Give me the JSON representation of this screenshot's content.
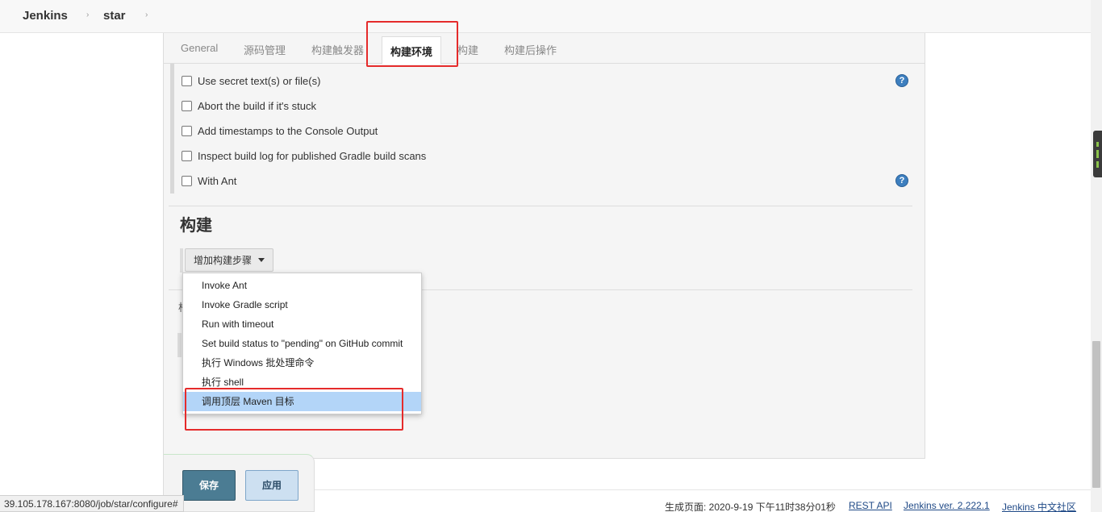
{
  "breadcrumb": {
    "items": [
      "Jenkins",
      "star"
    ],
    "separator": "›"
  },
  "tabs": [
    {
      "label": "General",
      "active": false
    },
    {
      "label": "源码管理",
      "active": false
    },
    {
      "label": "构建触发器",
      "active": false
    },
    {
      "label": "构建环境",
      "active": true
    },
    {
      "label": "构建",
      "active": false
    },
    {
      "label": "构建后操作",
      "active": false
    }
  ],
  "build_env": {
    "options": [
      {
        "label": "Use secret text(s) or file(s)",
        "checked": false,
        "help": true
      },
      {
        "label": "Abort the build if it's stuck",
        "checked": false,
        "help": false
      },
      {
        "label": "Add timestamps to the Console Output",
        "checked": false,
        "help": false
      },
      {
        "label": "Inspect build log for published Gradle build scans",
        "checked": false,
        "help": false
      },
      {
        "label": "With Ant",
        "checked": false,
        "help": true
      }
    ],
    "help_glyph": "?"
  },
  "build_section": {
    "title": "构建",
    "add_step_label": "增加构建步骤",
    "hidden_section_stub": "构"
  },
  "dropdown": {
    "items": [
      {
        "label": "Invoke Ant",
        "selected": false
      },
      {
        "label": "Invoke Gradle script",
        "selected": false
      },
      {
        "label": "Run with timeout",
        "selected": false
      },
      {
        "label": "Set build status to \"pending\" on GitHub commit",
        "selected": false
      },
      {
        "label": "执行 Windows 批处理命令",
        "selected": false
      },
      {
        "label": "执行 shell",
        "selected": false
      },
      {
        "label": "调用顶层 Maven 目标",
        "selected": true
      }
    ]
  },
  "actions": {
    "save_label": "保存",
    "apply_label": "应用"
  },
  "status_bar": {
    "url": "39.105.178.167:8080/job/star/configure#"
  },
  "footer": {
    "generated": "生成页面: 2020-9-19 下午11时38分01秒",
    "rest_api": "REST API",
    "version": "Jenkins ver. 2.222.1",
    "community": "Jenkins 中文社区"
  },
  "colors": {
    "annotation_red": "#e52b2b",
    "save_button": "#4b7c93",
    "apply_button": "#cde0f1",
    "selected_item": "#b3d5f8",
    "help_icon": "#3d7fbf"
  }
}
